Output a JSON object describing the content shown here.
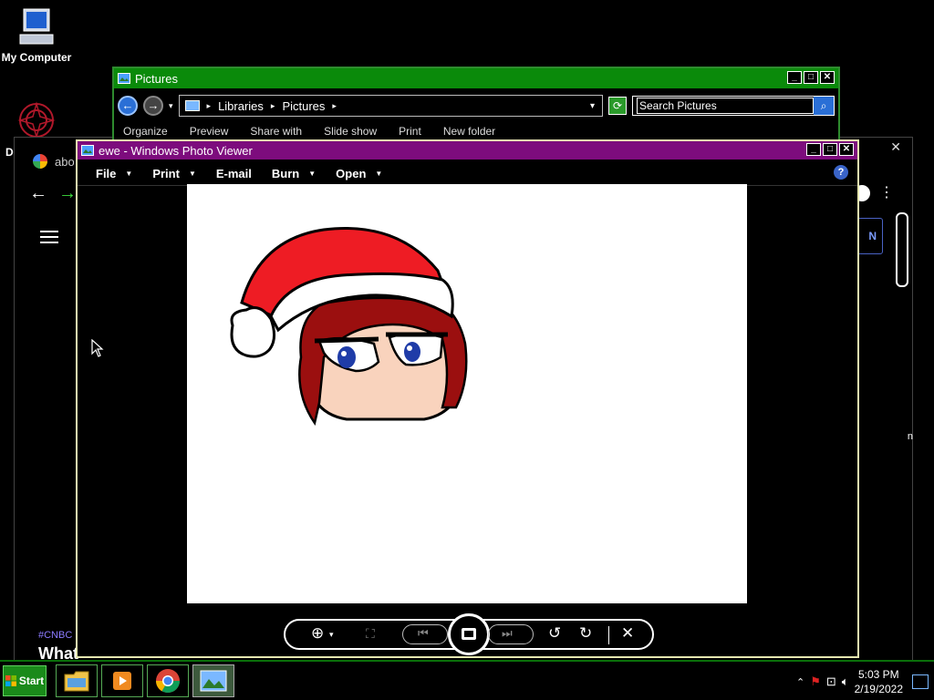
{
  "desktop": {
    "my_computer_label": "My Computer",
    "partial_icon_label": "D"
  },
  "pictures_window": {
    "title": "Pictures",
    "breadcrumb": [
      "Libraries",
      "Pictures"
    ],
    "search_placeholder": "Search Pictures",
    "commands": [
      "Organize",
      "Preview",
      "Share with",
      "Slide show",
      "Print",
      "New folder"
    ]
  },
  "chrome_window": {
    "tab_title": "abo",
    "signin_label": "N",
    "tag_text": "#CNBC",
    "headline_fragment": "What",
    "edge_letter": "n"
  },
  "viewer": {
    "title": "ewe - Windows Photo Viewer",
    "menu": [
      {
        "label": "File"
      },
      {
        "label": "Print"
      },
      {
        "label": "E-mail"
      },
      {
        "label": "Burn"
      },
      {
        "label": "Open"
      }
    ],
    "help_label": "?"
  },
  "taskbar": {
    "start_label": "Start",
    "time": "5:03 PM",
    "date": "2/19/2022"
  },
  "colors": {
    "viewer_title": "#7d0c7d",
    "explorer_title": "#0a8a0a",
    "taskbar_border": "#0a6f0a"
  }
}
